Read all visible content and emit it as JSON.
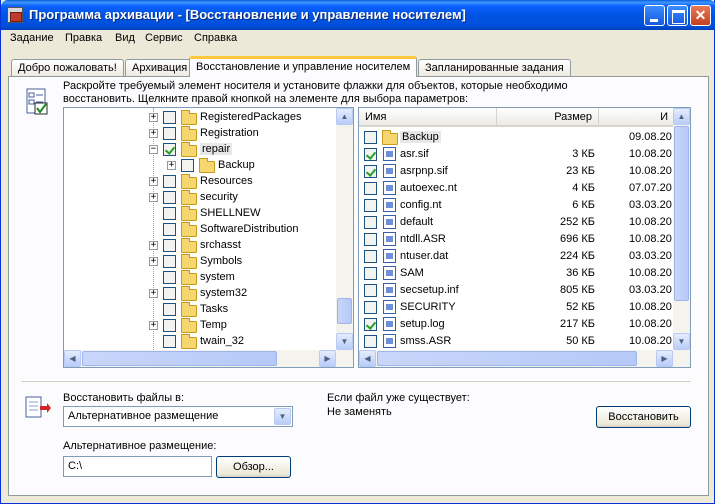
{
  "window": {
    "title": "Программа архивации - [Восстановление и управление носителем]",
    "buttons": {
      "minimize": "",
      "maximize": "",
      "close": "✕"
    }
  },
  "menu": [
    "Задание",
    "Правка",
    "Вид",
    "Сервис",
    "Справка"
  ],
  "tabs": [
    {
      "label": "Добро пожаловать!",
      "active": false
    },
    {
      "label": "Архивация",
      "active": false
    },
    {
      "label": "Восстановление и управление носителем",
      "active": true
    },
    {
      "label": "Запланированные задания",
      "active": false
    }
  ],
  "hint": "Раскройте требуемый элемент носителя и установите флажки для объектов, которые необходимо восстановить. Щелкните правой кнопкой на элементе для выбора параметров:",
  "tree": {
    "items": [
      {
        "label": "RegisteredPackages",
        "expander": "+",
        "checked": false,
        "indent": 0
      },
      {
        "label": "Registration",
        "expander": "+",
        "checked": false,
        "indent": 0
      },
      {
        "label": "repair",
        "expander": "−",
        "checked": true,
        "indent": 0,
        "selected": true
      },
      {
        "label": "Backup",
        "expander": "+",
        "checked": false,
        "indent": 1
      },
      {
        "label": "Resources",
        "expander": "+",
        "checked": false,
        "indent": 0
      },
      {
        "label": "security",
        "expander": "+",
        "checked": false,
        "indent": 0
      },
      {
        "label": "SHELLNEW",
        "expander": "",
        "checked": false,
        "indent": 0
      },
      {
        "label": "SoftwareDistribution",
        "expander": "",
        "checked": false,
        "indent": 0
      },
      {
        "label": "srchasst",
        "expander": "+",
        "checked": false,
        "indent": 0
      },
      {
        "label": "Symbols",
        "expander": "+",
        "checked": false,
        "indent": 0
      },
      {
        "label": "system",
        "expander": "",
        "checked": false,
        "indent": 0
      },
      {
        "label": "system32",
        "expander": "+",
        "checked": false,
        "indent": 0
      },
      {
        "label": "Tasks",
        "expander": "",
        "checked": false,
        "indent": 0
      },
      {
        "label": "Temp",
        "expander": "+",
        "checked": false,
        "indent": 0
      },
      {
        "label": "twain_32",
        "expander": "",
        "checked": false,
        "indent": 0
      }
    ]
  },
  "list": {
    "columns": {
      "name": "Имя",
      "size": "Размер",
      "date": "И"
    },
    "rows": [
      {
        "name": "Backup",
        "size": "",
        "date": "09.08.20",
        "checked": false,
        "type": "folder",
        "selected": true
      },
      {
        "name": "asr.sif",
        "size": "3 КБ",
        "date": "10.08.20",
        "checked": true,
        "type": "file"
      },
      {
        "name": "asrpnp.sif",
        "size": "23 КБ",
        "date": "10.08.20",
        "checked": true,
        "type": "file"
      },
      {
        "name": "autoexec.nt",
        "size": "4 КБ",
        "date": "07.07.20",
        "checked": false,
        "type": "file"
      },
      {
        "name": "config.nt",
        "size": "6 КБ",
        "date": "03.03.20",
        "checked": false,
        "type": "file"
      },
      {
        "name": "default",
        "size": "252 КБ",
        "date": "10.08.20",
        "checked": false,
        "type": "file"
      },
      {
        "name": "ntdll.ASR",
        "size": "696 КБ",
        "date": "10.08.20",
        "checked": false,
        "type": "file"
      },
      {
        "name": "ntuser.dat",
        "size": "224 КБ",
        "date": "03.03.20",
        "checked": false,
        "type": "file"
      },
      {
        "name": "SAM",
        "size": "36 КБ",
        "date": "10.08.20",
        "checked": false,
        "type": "file"
      },
      {
        "name": "secsetup.inf",
        "size": "805 КБ",
        "date": "03.03.20",
        "checked": false,
        "type": "file"
      },
      {
        "name": "SECURITY",
        "size": "52 КБ",
        "date": "10.08.20",
        "checked": false,
        "type": "file"
      },
      {
        "name": "setup.log",
        "size": "217 КБ",
        "date": "10.08.20",
        "checked": true,
        "type": "file"
      },
      {
        "name": "smss.ASR",
        "size": "50 КБ",
        "date": "10.08.20",
        "checked": false,
        "type": "file"
      }
    ]
  },
  "restore": {
    "restore_to_label": "Восстановить файлы в:",
    "restore_to_value": "Альтернативное размещение",
    "if_exists_label": "Если файл уже существует:",
    "if_exists_value": "Не заменять",
    "restore_button": "Восстановить",
    "alt_location_label": "Альтернативное размещение:",
    "alt_location_value": "C:\\",
    "browse_button": "Обзор..."
  },
  "icons": {
    "app": "backup-app-icon",
    "hint": "checklist-icon",
    "restore": "restore-arrow-icon"
  }
}
